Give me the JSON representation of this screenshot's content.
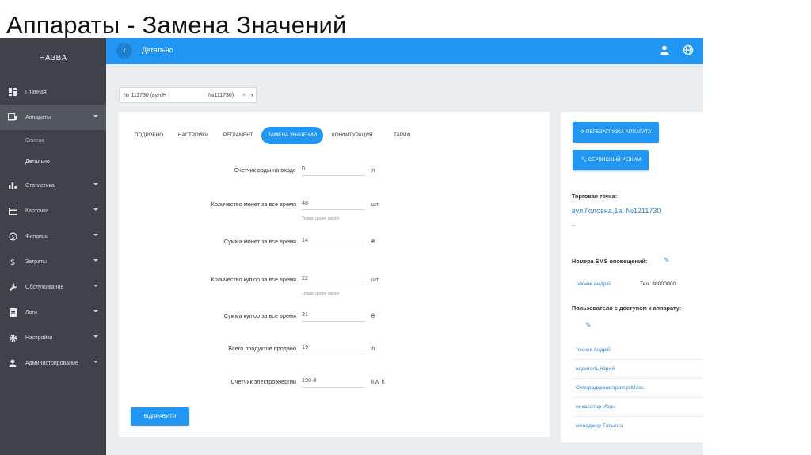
{
  "slide_title": "Аппараты - Замена Значений",
  "sidebar": {
    "brand": "НАЗВА",
    "items": [
      {
        "label": "Главная",
        "icon": "dashboard-icon",
        "caret": false
      },
      {
        "label": "Аппараты",
        "icon": "devices-icon",
        "caret": true,
        "active": true
      },
      {
        "label": "Статистика",
        "icon": "bar-chart-icon",
        "caret": true
      },
      {
        "label": "Карточки",
        "icon": "card-icon",
        "caret": true
      },
      {
        "label": "Финансы",
        "icon": "finance-icon",
        "caret": true
      },
      {
        "label": "Затраты",
        "icon": "dollar-icon",
        "caret": true
      },
      {
        "label": "Обслуживание",
        "icon": "wrench-icon",
        "caret": true
      },
      {
        "label": "Логи",
        "icon": "log-icon",
        "caret": true
      },
      {
        "label": "Настройки",
        "icon": "gear-icon",
        "caret": true
      },
      {
        "label": "Администрирование",
        "icon": "person-icon",
        "caret": true
      }
    ],
    "subitems": [
      "Список",
      "Детально"
    ]
  },
  "topbar": {
    "back": "‹",
    "title": "Детально"
  },
  "device_select": {
    "value": "№ 111730 (вул.Н",
    "number": "№111730)",
    "clear": "×",
    "arrow": "▾"
  },
  "tabs": [
    "ПОДРОБНО",
    "НАСТРОЙКИ",
    "РЕГЛАМЕНТ",
    "ЗАМЕНА ЗНАЧЕНИЙ",
    "КОНФИГУРАЦИЯ",
    "ТАРИФ"
  ],
  "form": {
    "rows": [
      {
        "label": "Счетчик воды на входе",
        "value": "0",
        "unit": "л"
      },
      {
        "label": "Количество монет за все время",
        "value": "48",
        "unit": "шт",
        "hint": "Только целое число!"
      },
      {
        "label": "Сумма монет за все время",
        "value": "14",
        "unit": "₴"
      },
      {
        "label": "Количество купюр за все время",
        "value": "22",
        "unit": "шт",
        "hint": "Только целое число!"
      },
      {
        "label": "Сумма купюр за все время",
        "value": "31",
        "unit": "₴"
      },
      {
        "label": "Всего продуктов продано",
        "value": "19",
        "unit": "л"
      },
      {
        "label": "Счетчик электроэнергии",
        "value": "190.4",
        "unit": "kW h"
      }
    ],
    "submit": "ВІДПРАВИТИ"
  },
  "right_panel": {
    "reboot_button": "ПЕРЕЗАГРУЗКА АППАРАТА",
    "service_button": "СЕРВИСНЫЙ РЕЖИМ",
    "trade_point_label": "Торговая точка:",
    "trade_point_value": "вул.Головна,1а; №1211730",
    "trade_point_extra": "--",
    "sms_label": "Номера SMS оповещений:",
    "sms_name": "техник Андрій",
    "sms_phone": "Тел. 38000000",
    "users_label": "Пользователи с доступом к аппарату:",
    "users": [
      "техник Андрій",
      "водитель Юрий",
      "Суперадминистратор Макс",
      "инкасатор Иван",
      "менеджер Татьяна"
    ]
  },
  "colors": {
    "accent": "#2196f3",
    "sidebar": "#3f4349",
    "background": "#ebeef1"
  }
}
